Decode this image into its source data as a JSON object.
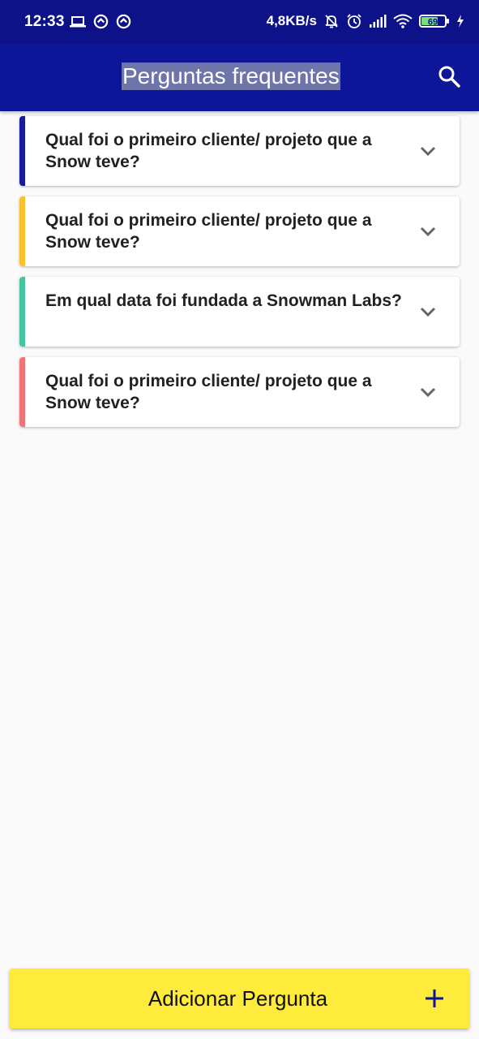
{
  "status_bar": {
    "time": "12:33",
    "speed": "4,8KB/s",
    "battery": "69",
    "icons": [
      "laptop-icon",
      "data-saver-icon",
      "data-saver-icon",
      "notifications-off-icon",
      "alarm-icon",
      "signal-icon",
      "wifi-icon",
      "battery-icon",
      "charging-icon"
    ]
  },
  "app_bar": {
    "title": "Perguntas frequentes",
    "search_icon": "search-icon"
  },
  "faqs": [
    {
      "question": "Qual foi o primeiro cliente/ projeto que a Snow teve?",
      "accent": "#161c9b"
    },
    {
      "question": "Qual foi o primeiro cliente/ projeto que a Snow teve?",
      "accent": "#fbc02d"
    },
    {
      "question": "Em qual data foi fundada a Snowman Labs?",
      "accent": "#45c4a0"
    },
    {
      "question": "Qual foi o primeiro cliente/ projeto que a Snow teve?",
      "accent": "#f0737a"
    }
  ],
  "add_button": {
    "label": "Adicionar Pergunta",
    "icon": "plus-icon"
  },
  "colors": {
    "status_bar": "#0d1288",
    "app_bar": "#0d1699",
    "background": "#fafafa",
    "add_button": "#ffeb3b",
    "accent_dark": "#161c9b"
  }
}
